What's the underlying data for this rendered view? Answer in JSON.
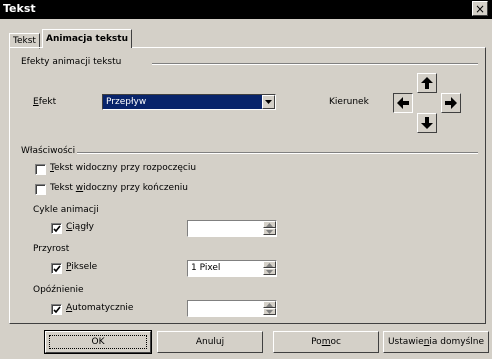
{
  "window": {
    "title": "Tekst",
    "close_glyph": "×"
  },
  "tabs": [
    {
      "label": "Tekst"
    },
    {
      "label": "Animacja tekstu",
      "active": true
    }
  ],
  "effects": {
    "group_title": "Efekty animacji tekstu",
    "effect_label_u": "E",
    "effect_label_rest": "fekt",
    "effect_value": "Przepływ",
    "direction_label": "Kierunek"
  },
  "direction_icons": [
    "arrow-up-icon",
    "arrow-left-icon",
    "arrow-right-icon",
    "arrow-down-icon"
  ],
  "properties": {
    "group_title": "Właściwości",
    "start_u": "T",
    "start_rest": "ekst widoczny przy rozpoczęciu",
    "start_checked": false,
    "end_prefix": "Tekst ",
    "end_u": "w",
    "end_rest": "idoczny przy kończeniu",
    "end_checked": false,
    "cycles_title": "Cykle animacji",
    "cont_u": "C",
    "cont_rest": "iągły",
    "cont_checked": true,
    "cont_value": "",
    "inc_title": "Przyrost",
    "pix_u": "P",
    "pix_rest": "iksele",
    "pix_checked": true,
    "pix_value": "1 Pixel",
    "delay_title": "Opóźnienie",
    "auto_u": "A",
    "auto_rest": "utomatycznie",
    "auto_checked": true,
    "auto_value": ""
  },
  "buttons": {
    "ok": "OK",
    "cancel": "Anuluj",
    "help_pre": "Po",
    "help_u": "m",
    "help_post": "oc",
    "reset_pre": "Ustawie",
    "reset_u": "n",
    "reset_post": "ia domyślne"
  },
  "colors": {
    "face": "#d4d0c8",
    "selection": "#08246b",
    "titlebar": "#000000"
  }
}
